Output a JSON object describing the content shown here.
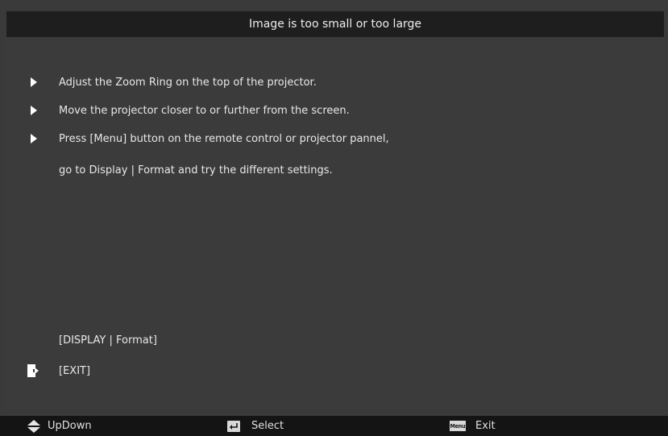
{
  "dialog": {
    "title": "Image is too small or too large"
  },
  "tips": [
    {
      "text": "Adjust the Zoom Ring on the top of the projector.",
      "bullet": "triangle-right-icon"
    },
    {
      "text": "Move the projector closer to or further from the screen.",
      "bullet": "triangle-right-icon"
    },
    {
      "text": "Press [Menu] button on the remote control or projector pannel,",
      "bullet": "triangle-right-icon"
    },
    {
      "text": "go to Display  |  Format and try the different settings.",
      "bullet": ""
    }
  ],
  "links": {
    "display_format": "[DISPLAY  |  Format]",
    "exit": "[EXIT]"
  },
  "footer": {
    "updown_label": "UpDown",
    "select_label": "Select",
    "menu_key_text": "Menu",
    "exit_label": "Exit"
  },
  "colors": {
    "panel": "#3b3b3b",
    "title_bar": "#1e1e1e",
    "footer": "#141414",
    "text": "#e8e8e8"
  }
}
